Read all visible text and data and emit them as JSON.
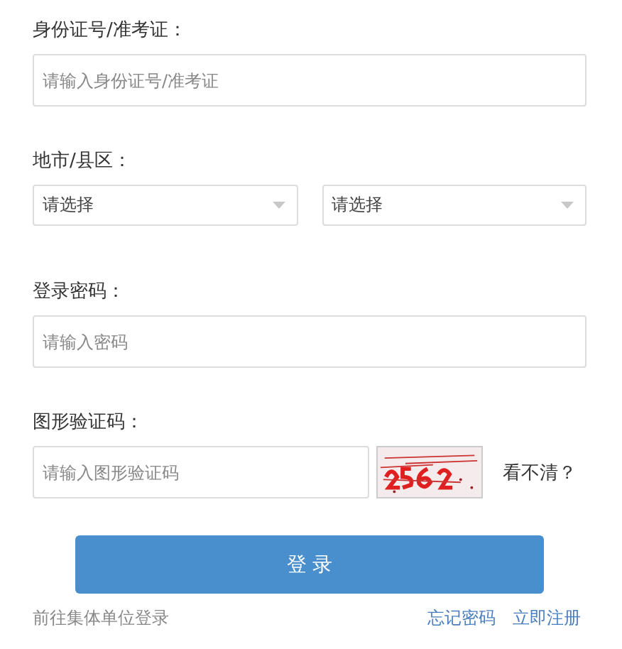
{
  "fields": [
    {
      "kind": "input",
      "label": "身份证号/准考证：",
      "placeholder": "请输入身份证号/准考证"
    },
    {
      "kind": "selects",
      "label": "地市/县区：",
      "selects": [
        {
          "value": "请选择"
        },
        {
          "value": "请选择"
        }
      ]
    },
    {
      "kind": "password",
      "label": "登录密码：",
      "placeholder": "请输入密码"
    },
    {
      "kind": "captcha",
      "label": "图形验证码：",
      "placeholder": "请输入图形验证码",
      "refresh": "看不清？"
    }
  ],
  "login_button": "登 录",
  "links": {
    "left": "前往集体单位登录",
    "right": [
      "忘记密码",
      "立即注册"
    ]
  }
}
